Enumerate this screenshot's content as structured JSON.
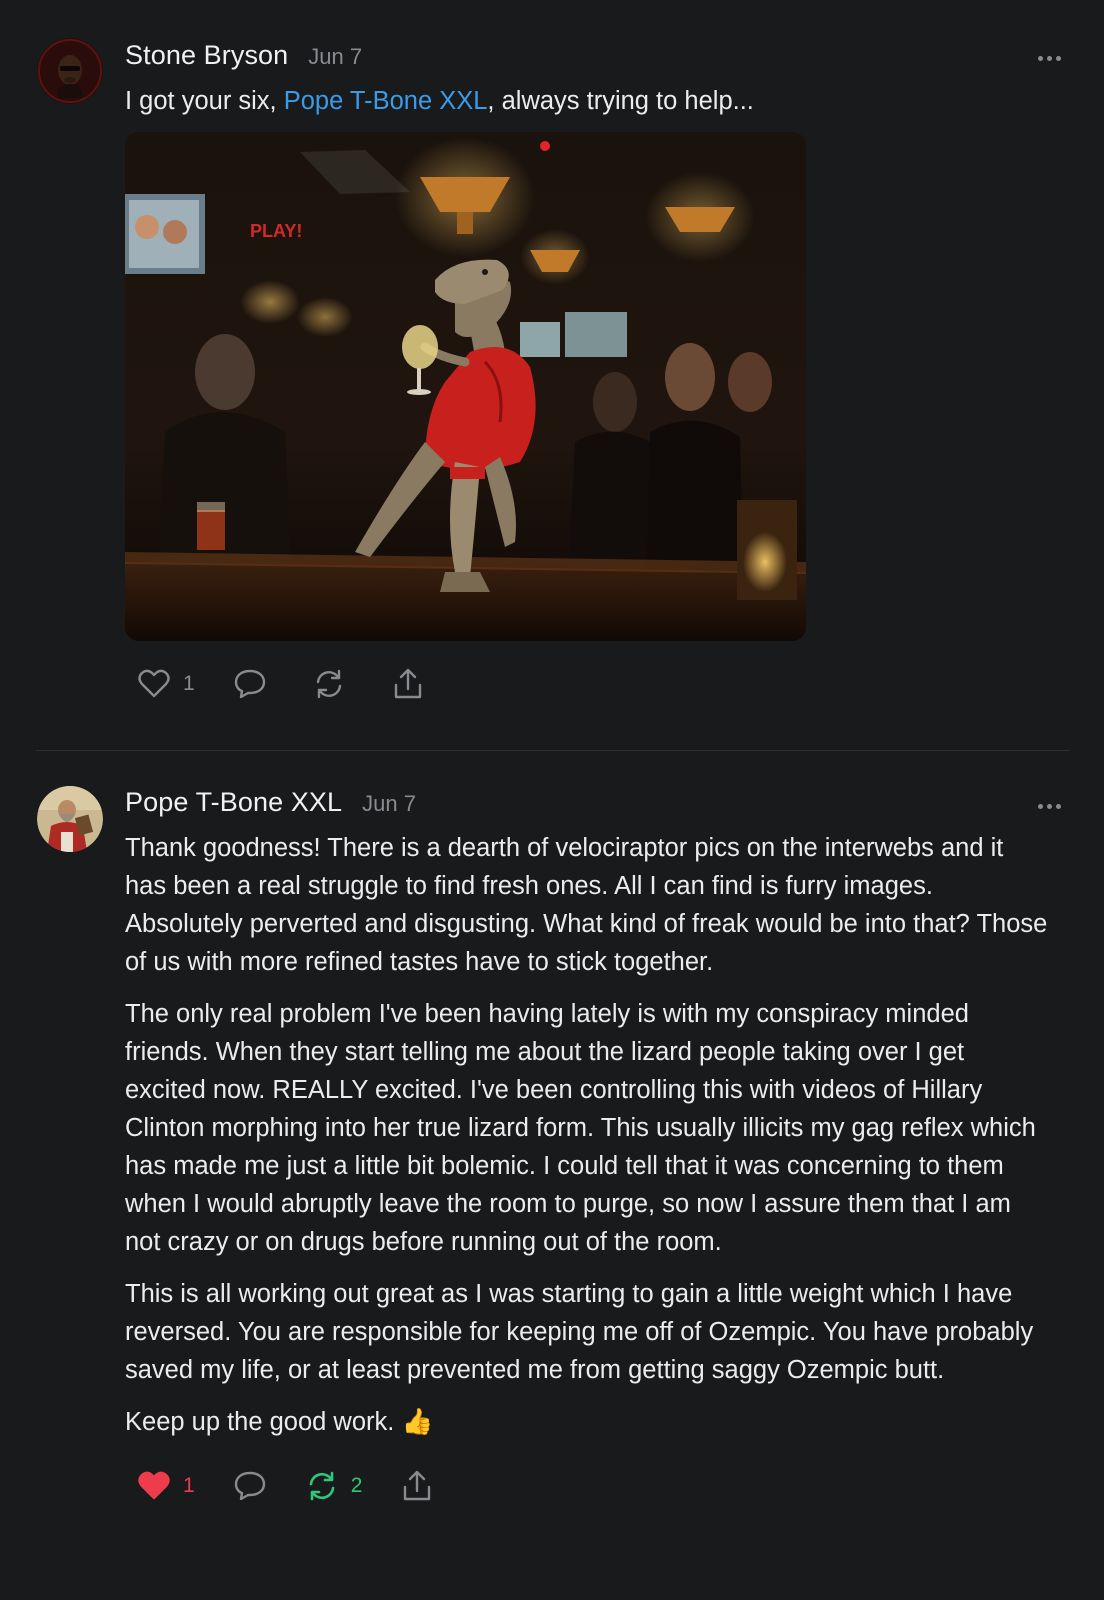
{
  "colors": {
    "background": "#191a1c",
    "mention": "#3b9be8",
    "like_active": "#ef3c4c",
    "repost_active": "#2fc77a",
    "muted": "#8a8b8f"
  },
  "posts": [
    {
      "author": "Stone Bryson",
      "date": "Jun 7",
      "text_before": "I got your six, ",
      "mention": "Pope T-Bone XXL",
      "text_after": ", always trying to help...",
      "image_description": "velociraptor in red dress holding a wine glass in a dim bar",
      "actions": {
        "like_count": "1",
        "like_active": false,
        "repost_count": "",
        "repost_active": false
      },
      "icons": [
        "heart-icon",
        "comment-icon",
        "repost-icon",
        "share-icon",
        "more-icon"
      ]
    },
    {
      "author": "Pope T-Bone XXL",
      "date": "Jun 7",
      "paragraphs": [
        "Thank goodness! There is a dearth of velociraptor pics on the interwebs and it has been a real struggle to find fresh ones. All I can find is furry images. Absolutely perverted and disgusting. What kind of freak would be into that? Those of us with more refined tastes have to stick together.",
        "The only real problem I've been having lately is with my conspiracy minded friends. When they start telling me about the lizard people taking over I get excited now. REALLY excited. I've been controlling this with videos of Hillary Clinton morphing into her true lizard form. This usually illicits my gag reflex which has made me just a little bit bolemic. I could tell that it was concerning to them when I would abruptly leave the room to purge, so now I assure them that I am not crazy or on drugs before running out of the room.",
        "This is all working out great as I was starting to gain a little weight which I have reversed. You are responsible for keeping me off of Ozempic. You have probably saved my life, or at least prevented me from getting saggy Ozempic butt.",
        "Keep up the good work. 👍"
      ],
      "actions": {
        "like_count": "1",
        "like_active": true,
        "repost_count": "2",
        "repost_active": true
      },
      "icons": [
        "heart-icon",
        "comment-icon",
        "repost-icon",
        "share-icon",
        "more-icon"
      ]
    }
  ]
}
